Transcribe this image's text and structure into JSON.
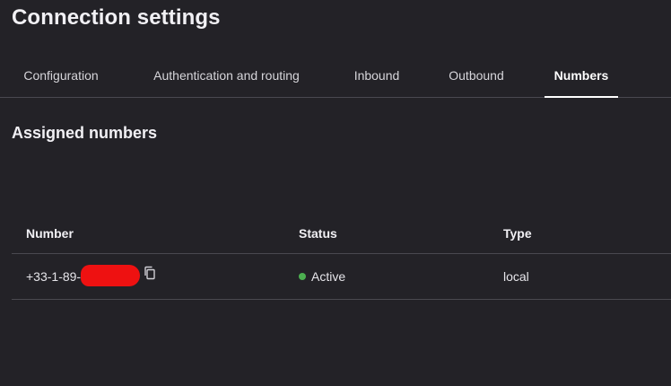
{
  "header": {
    "title": "Connection settings"
  },
  "tabs": [
    {
      "label": "Configuration",
      "active": false
    },
    {
      "label": "Authentication and routing",
      "active": false
    },
    {
      "label": "Inbound",
      "active": false
    },
    {
      "label": "Outbound",
      "active": false
    },
    {
      "label": "Numbers",
      "active": true
    }
  ],
  "section": {
    "title": "Assigned numbers"
  },
  "table": {
    "columns": [
      "Number",
      "Status",
      "Type"
    ],
    "rows": [
      {
        "number": "+33-1-89-",
        "number_redacted": true,
        "status": "Active",
        "status_color": "#4caf50",
        "type": "local"
      }
    ]
  },
  "icons": {
    "copy": "copy-icon",
    "status": "status-dot-icon"
  },
  "colors": {
    "background": "#232227",
    "divider": "#4a4950",
    "redaction": "#ee1111",
    "status_active": "#4caf50"
  }
}
